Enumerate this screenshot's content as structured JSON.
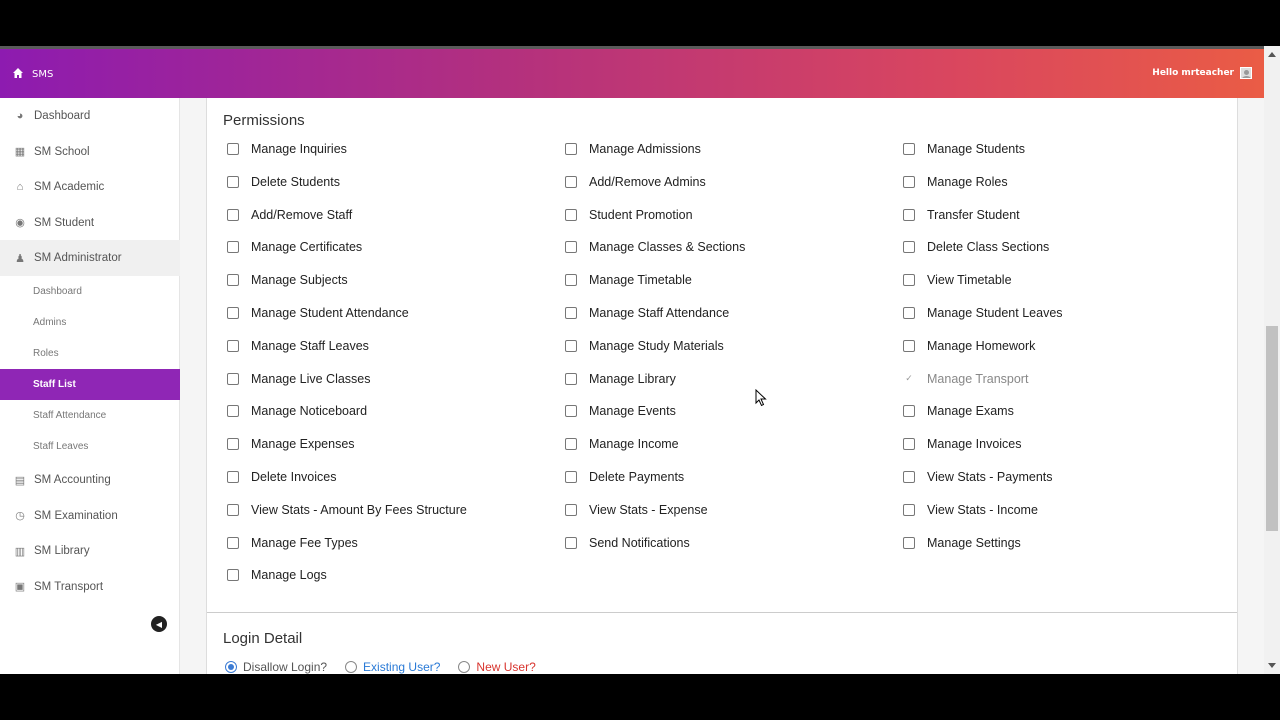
{
  "app": {
    "name": "SMS",
    "greeting": "Hello mrteacher"
  },
  "sidebar": {
    "items": [
      {
        "label": "Dashboard",
        "icon": "palette-icon"
      },
      {
        "label": "SM School",
        "icon": "building-icon"
      },
      {
        "label": "SM Academic",
        "icon": "graduation-cap-icon"
      },
      {
        "label": "SM Student",
        "icon": "users-icon"
      },
      {
        "label": "SM Administrator",
        "icon": "user-tie-icon"
      }
    ],
    "sub_items": [
      {
        "label": "Dashboard"
      },
      {
        "label": "Admins"
      },
      {
        "label": "Roles"
      },
      {
        "label": "Staff List"
      },
      {
        "label": "Staff Attendance"
      },
      {
        "label": "Staff Leaves"
      }
    ],
    "items_after": [
      {
        "label": "SM Accounting",
        "icon": "file-invoice-icon"
      },
      {
        "label": "SM Examination",
        "icon": "clock-icon"
      },
      {
        "label": "SM Library",
        "icon": "book-icon"
      },
      {
        "label": "SM Transport",
        "icon": "bus-icon"
      }
    ],
    "active_sub_item": "Staff List"
  },
  "permissions": {
    "title": "Permissions",
    "items": [
      {
        "label": "Manage Inquiries",
        "checked": false
      },
      {
        "label": "Manage Admissions",
        "checked": false
      },
      {
        "label": "Manage Students",
        "checked": false
      },
      {
        "label": "Delete Students",
        "checked": false
      },
      {
        "label": "Add/Remove Admins",
        "checked": false
      },
      {
        "label": "Manage Roles",
        "checked": false
      },
      {
        "label": "Add/Remove Staff",
        "checked": false
      },
      {
        "label": "Student Promotion",
        "checked": false
      },
      {
        "label": "Transfer Student",
        "checked": false
      },
      {
        "label": "Manage Certificates",
        "checked": false
      },
      {
        "label": "Manage Classes & Sections",
        "checked": false
      },
      {
        "label": "Delete Class Sections",
        "checked": false
      },
      {
        "label": "Manage Subjects",
        "checked": false
      },
      {
        "label": "Manage Timetable",
        "checked": false
      },
      {
        "label": "View Timetable",
        "checked": false
      },
      {
        "label": "Manage Student Attendance",
        "checked": false
      },
      {
        "label": "Manage Staff Attendance",
        "checked": false
      },
      {
        "label": "Manage Student Leaves",
        "checked": false
      },
      {
        "label": "Manage Staff Leaves",
        "checked": false
      },
      {
        "label": "Manage Study Materials",
        "checked": false
      },
      {
        "label": "Manage Homework",
        "checked": false
      },
      {
        "label": "Manage Live Classes",
        "checked": false
      },
      {
        "label": "Manage Library",
        "checked": false
      },
      {
        "label": "Manage Transport",
        "checked": true,
        "disabled": true
      },
      {
        "label": "Manage Noticeboard",
        "checked": false
      },
      {
        "label": "Manage Events",
        "checked": false
      },
      {
        "label": "Manage Exams",
        "checked": false
      },
      {
        "label": "Manage Expenses",
        "checked": false
      },
      {
        "label": "Manage Income",
        "checked": false
      },
      {
        "label": "Manage Invoices",
        "checked": false
      },
      {
        "label": "Delete Invoices",
        "checked": false
      },
      {
        "label": "Delete Payments",
        "checked": false
      },
      {
        "label": "View Stats - Payments",
        "checked": false
      },
      {
        "label": "View Stats - Amount By Fees Structure",
        "checked": false
      },
      {
        "label": "View Stats - Expense",
        "checked": false
      },
      {
        "label": "View Stats - Income",
        "checked": false
      },
      {
        "label": "Manage Fee Types",
        "checked": false
      },
      {
        "label": "Send Notifications",
        "checked": false
      },
      {
        "label": "Manage Settings",
        "checked": false
      },
      {
        "label": "Manage Logs",
        "checked": false
      }
    ]
  },
  "login_detail": {
    "title": "Login Detail",
    "options": [
      {
        "label": "Disallow Login?",
        "selected": true,
        "color": "#555555"
      },
      {
        "label": "Existing User?",
        "selected": false,
        "color": "#2a7ad6"
      },
      {
        "label": "New User?",
        "selected": false,
        "color": "#d8352f"
      }
    ]
  },
  "colors": {
    "accent": "#8f26b5",
    "header_start": "#8d1bb0",
    "header_end": "#ea5c45"
  }
}
